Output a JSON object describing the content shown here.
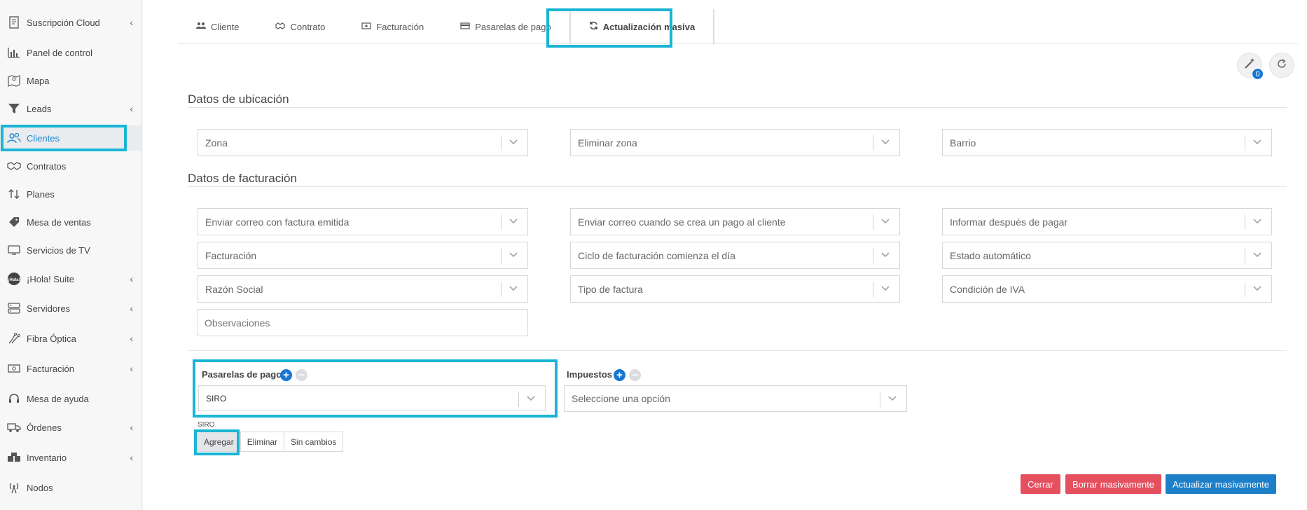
{
  "sidebar": {
    "items": [
      {
        "label": "Suscripción Cloud",
        "icon": "document-icon",
        "chevron": "‹"
      },
      {
        "label": "Panel de control",
        "icon": "bar-chart-icon",
        "chevron": ""
      },
      {
        "label": "Mapa",
        "icon": "map-icon",
        "chevron": ""
      },
      {
        "label": "Leads",
        "icon": "funnel-icon",
        "chevron": "‹"
      },
      {
        "label": "Clientes",
        "icon": "users-icon",
        "chevron": ""
      },
      {
        "label": "Contratos",
        "icon": "handshake-icon",
        "chevron": ""
      },
      {
        "label": "Planes",
        "icon": "arrows-updown-icon",
        "chevron": ""
      },
      {
        "label": "Mesa de ventas",
        "icon": "tag-icon",
        "chevron": ""
      },
      {
        "label": "Servicios de TV",
        "icon": "tv-icon",
        "chevron": ""
      },
      {
        "label": "¡Hola! Suite",
        "icon": "hola-logo-icon",
        "chevron": "‹"
      },
      {
        "label": "Servidores",
        "icon": "server-icon",
        "chevron": "‹"
      },
      {
        "label": "Fibra Óptica",
        "icon": "fiber-icon",
        "chevron": "‹"
      },
      {
        "label": "Facturación",
        "icon": "money-icon",
        "chevron": "‹"
      },
      {
        "label": "Mesa de ayuda",
        "icon": "headset-icon",
        "chevron": ""
      },
      {
        "label": "Órdenes",
        "icon": "truck-icon",
        "chevron": "‹"
      },
      {
        "label": "Inventario",
        "icon": "boxes-icon",
        "chevron": "‹"
      },
      {
        "label": "Nodos",
        "icon": "antenna-icon",
        "chevron": ""
      }
    ]
  },
  "tabs": [
    {
      "label": "Cliente",
      "icon": "users-icon"
    },
    {
      "label": "Contrato",
      "icon": "handshake-icon"
    },
    {
      "label": "Facturación",
      "icon": "money-icon"
    },
    {
      "label": "Pasarelas de pago",
      "icon": "card-icon"
    },
    {
      "label": "Actualización masiva",
      "icon": "sync-icon"
    }
  ],
  "badge_count": "0",
  "sections": {
    "ubicacion": "Datos de ubicación",
    "facturacion": "Datos de facturación"
  },
  "fields": {
    "zona": "Zona",
    "eliminar_zona": "Eliminar zona",
    "barrio": "Barrio",
    "enviar_correo_factura": "Enviar correo con factura emitida",
    "enviar_correo_pago": "Enviar correo cuando se crea un pago al cliente",
    "informar_pagar": "Informar después de pagar",
    "facturacion": "Facturación",
    "ciclo": "Ciclo de facturación comienza el día",
    "estado_auto": "Estado automático",
    "razon_social": "Razón Social",
    "tipo_factura": "Tipo de factura",
    "condicion_iva": "Condición de IVA",
    "observaciones_placeholder": "Observaciones"
  },
  "pasarelas": {
    "label": "Pasarelas de pago",
    "value": "SIRO",
    "sub_label": "SIRO",
    "buttons": [
      "Agregar",
      "Eliminar",
      "Sin cambios"
    ]
  },
  "impuestos": {
    "label": "Impuestos",
    "placeholder": "Seleccione una opción"
  },
  "actions": {
    "cerrar": "Cerrar",
    "borrar": "Borrar masivamente",
    "actualizar": "Actualizar masivamente"
  },
  "colors": {
    "accent": "#1976d2",
    "highlight": "#1ab5d4",
    "danger": "#e5505f"
  }
}
